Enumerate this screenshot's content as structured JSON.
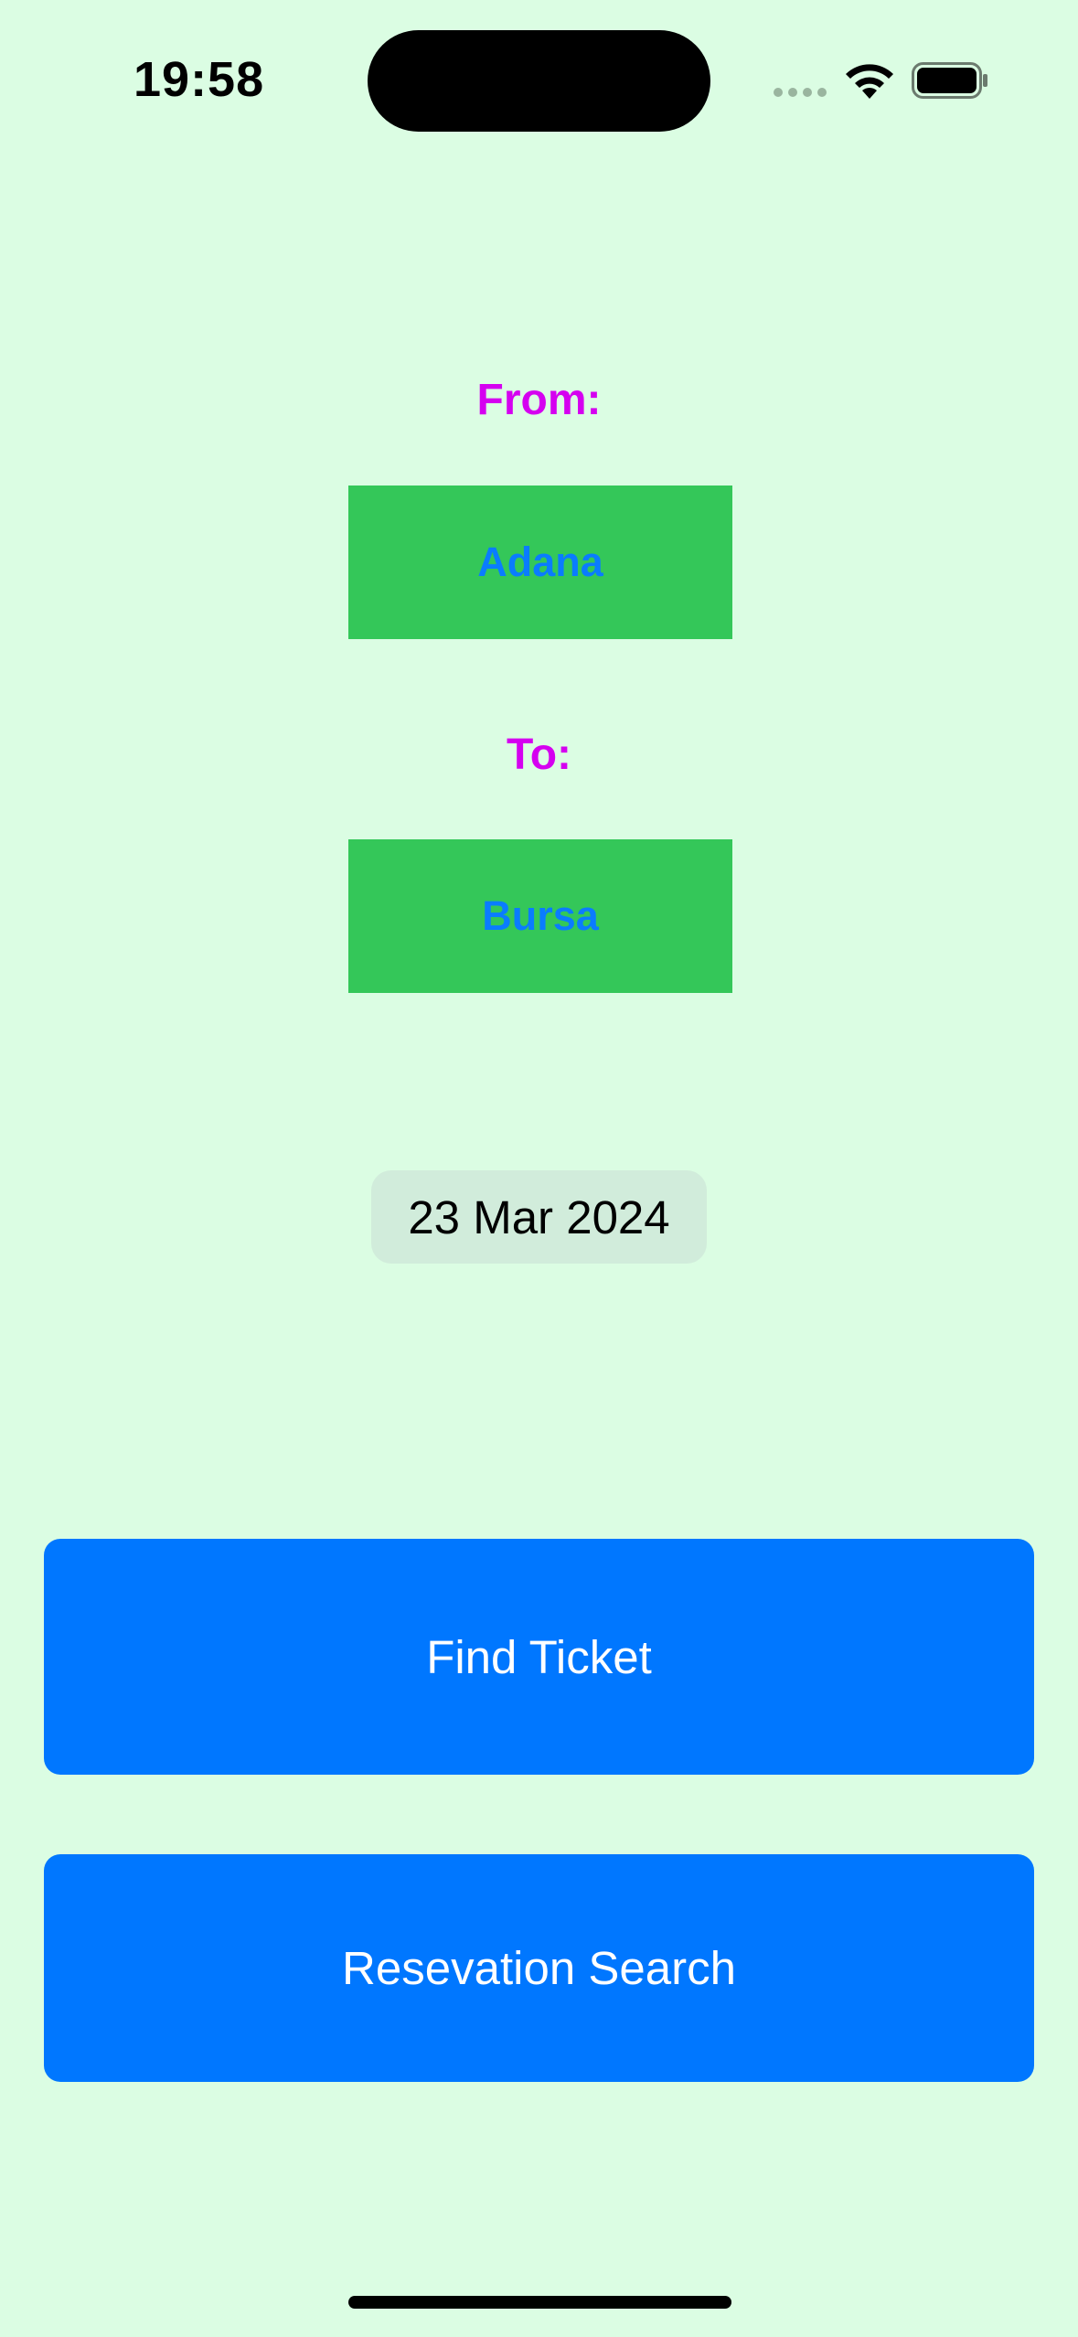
{
  "status_bar": {
    "time": "19:58",
    "icons": [
      "cellular-signal-icon",
      "wifi-icon",
      "battery-icon"
    ]
  },
  "form": {
    "from_label": "From:",
    "from_value": "Adana",
    "to_label": "To:",
    "to_value": "Bursa",
    "date": "23 Mar 2024"
  },
  "actions": {
    "find_ticket": "Find Ticket",
    "reservation_search": "Resevation Search"
  },
  "colors": {
    "background": "#dbfde3",
    "label": "#d500f0",
    "city_button_bg": "#34c759",
    "city_button_text": "#0a7cff",
    "primary_button": "#0077ff"
  }
}
